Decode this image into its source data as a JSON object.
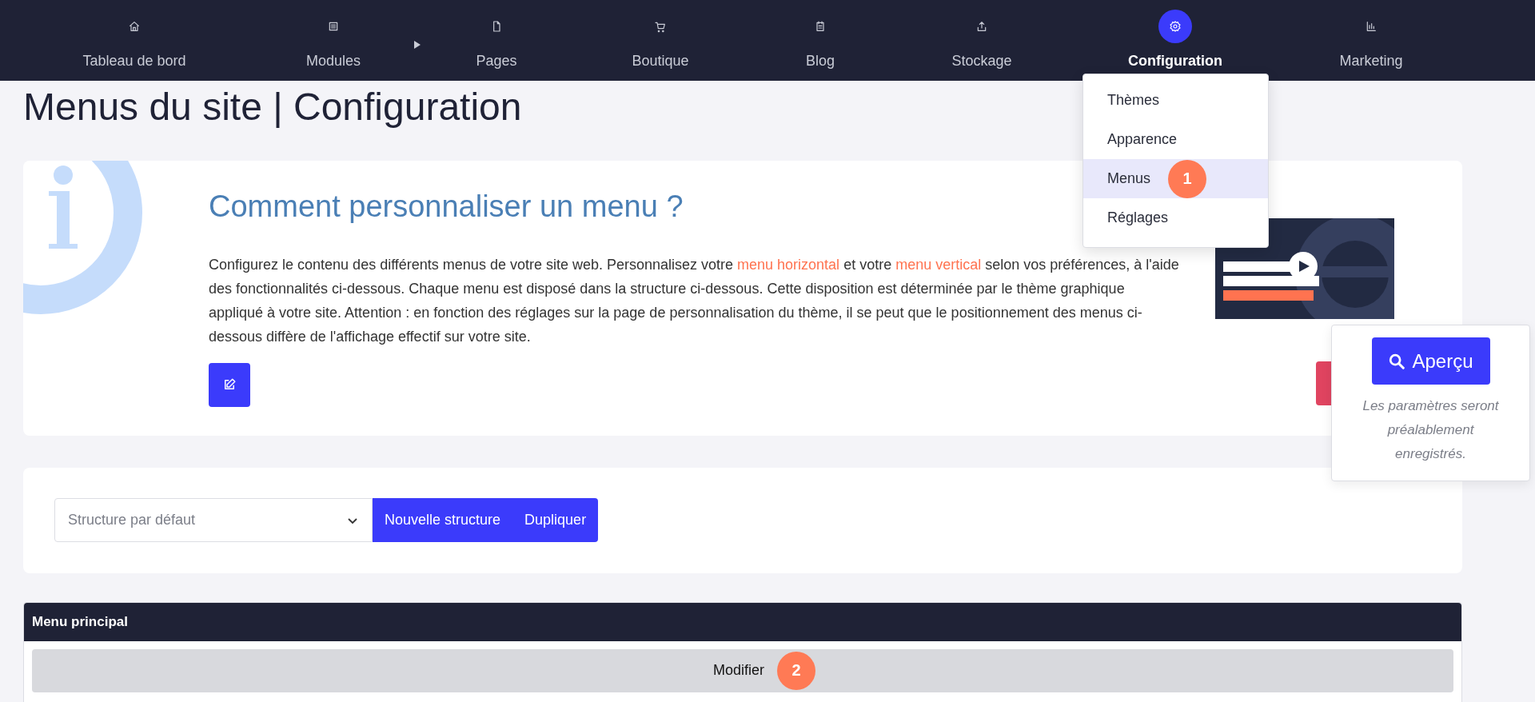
{
  "nav": {
    "items": [
      {
        "label": "Tableau de bord",
        "selected": false
      },
      {
        "label": "Modules",
        "selected": false
      },
      {
        "label": "Pages",
        "selected": false
      },
      {
        "label": "Boutique",
        "selected": false
      },
      {
        "label": "Blog",
        "selected": false
      },
      {
        "label": "Stockage",
        "selected": false
      },
      {
        "label": "Configuration",
        "selected": true
      },
      {
        "label": "Marketing",
        "selected": false
      }
    ]
  },
  "dropdown": {
    "items": [
      {
        "label": "Thèmes",
        "selected": false
      },
      {
        "label": "Apparence",
        "selected": false
      },
      {
        "label": "Menus",
        "selected": true,
        "badge": "1"
      },
      {
        "label": "Réglages",
        "selected": false
      }
    ]
  },
  "page_title": "Menus du site | Configuration",
  "info": {
    "title": "Comment personnaliser un menu ?",
    "paragraph": [
      {
        "text": "Configurez le contenu des différents menus de votre site web. Personnalisez votre ",
        "kind": "text"
      },
      {
        "text": "menu horizontal",
        "kind": "link"
      },
      {
        "text": " et votre ",
        "kind": "text"
      },
      {
        "text": "menu vertical",
        "kind": "link"
      },
      {
        "text": " selon vos préférences, à l'aide des fonctionnalités ci-dessous. Chaque menu est disposé dans la structure ci-dessous. Cette disposition est déterminée par le thème graphique appliqué à votre site. Attention : en fonction des réglages sur la page de personnalisation du thème, il se peut que le positionnement des menus ci-dessous diffère de l'affichage effectif sur votre site.",
        "kind": "text"
      }
    ]
  },
  "preview": {
    "button": "Aperçu",
    "note": "Les paramètres seront préalablement enregistrés."
  },
  "structure": {
    "select_value": "Structure par défaut",
    "buttons": [
      "Nouvelle structure",
      "Dupliquer"
    ]
  },
  "menu_panel": {
    "title": "Menu principal",
    "action": "Modifier",
    "badge": "2"
  }
}
